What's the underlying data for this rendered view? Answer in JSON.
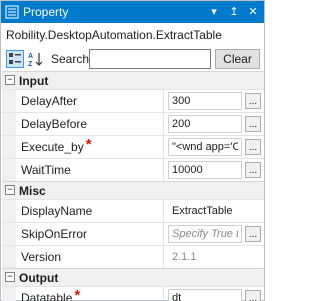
{
  "window": {
    "title": "Property",
    "pin_glyph": "↥",
    "close_glyph": "✕",
    "dropdown_glyph": "▾"
  },
  "type_line": "Robility.DesktopAutomation.ExtractTable",
  "toolbar": {
    "search_label": "Search:",
    "search_value": "",
    "clear_label": "Clear"
  },
  "categories": [
    {
      "toggle": "−",
      "name": "Input",
      "rows": [
        {
          "name": "DelayAfter",
          "required": false,
          "value": "300",
          "placeholder": "",
          "ellipsis": "...",
          "readonly": false
        },
        {
          "name": "DelayBefore",
          "required": false,
          "value": "200",
          "placeholder": "",
          "ellipsis": "...",
          "readonly": false
        },
        {
          "name": "Execute_by",
          "required": true,
          "value": "\"<wnd app='C:",
          "placeholder": "",
          "ellipsis": "...",
          "readonly": false
        },
        {
          "name": "WaitTime",
          "required": false,
          "value": "10000",
          "placeholder": "",
          "ellipsis": "...",
          "readonly": false
        }
      ]
    },
    {
      "toggle": "−",
      "name": "Misc",
      "rows": [
        {
          "name": "DisplayName",
          "required": false,
          "value": "ExtractTable",
          "placeholder": "",
          "ellipsis": "",
          "readonly": false
        },
        {
          "name": "SkipOnError",
          "required": false,
          "value": "",
          "placeholder": "Specify True to",
          "ellipsis": "...",
          "readonly": false
        },
        {
          "name": "Version",
          "required": false,
          "value": "2.1.1",
          "placeholder": "",
          "ellipsis": "",
          "readonly": true
        }
      ]
    },
    {
      "toggle": "−",
      "name": "Output",
      "rows": [
        {
          "name": "Datatable",
          "required": true,
          "value": "dt",
          "placeholder": "",
          "ellipsis": "...",
          "readonly": false
        }
      ]
    }
  ],
  "required_mark": "*",
  "colors": {
    "titlebar": "#007acc",
    "required": "#e51400",
    "category_bg": "#f0f0f0"
  }
}
